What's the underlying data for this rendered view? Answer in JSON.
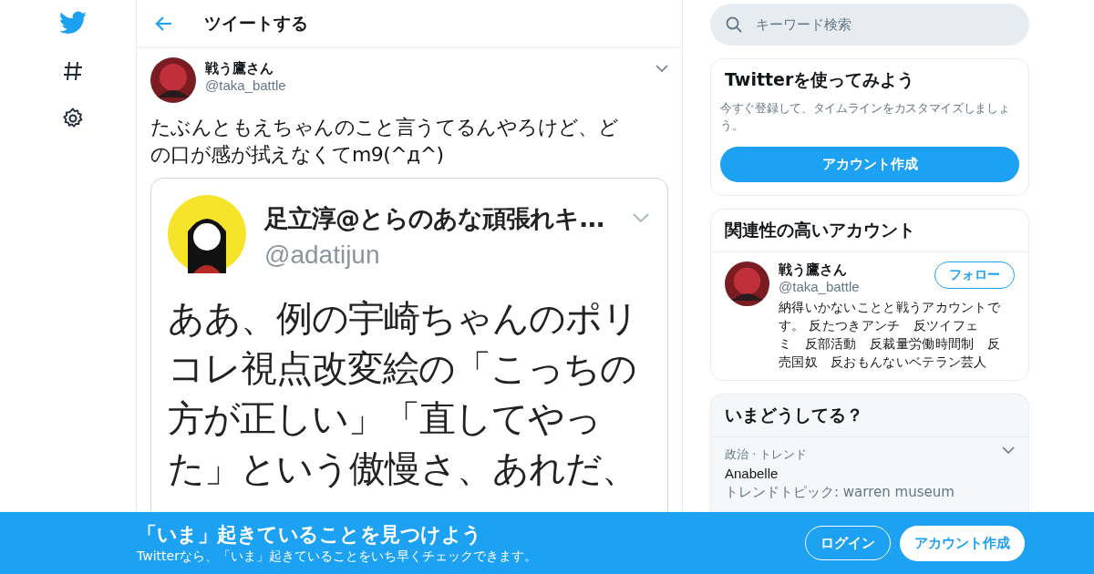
{
  "header": {
    "title": "ツイートする"
  },
  "tweet": {
    "name": "戦う鷹さん",
    "handle": "@taka_battle",
    "text_lines": [
      "たぶんともえちゃんのこと言うてるんやろけど、ど",
      "の口が感が拭えなくてm9(^д^)"
    ],
    "embedded_screenshot": {
      "name": "足立淳@とらのあな頑張れキ...",
      "handle": "@adatijun",
      "text_lines": [
        "ああ、例の宇崎ちゃんのポリ",
        "コレ視点改変絵の「こっちの",
        "方が正しい」「直してやっ",
        "た」という傲慢さ、あれだ、"
      ]
    }
  },
  "search": {
    "placeholder": "キーワード検索"
  },
  "signup_card": {
    "title": "Twitterを使ってみよう",
    "text": "今すぐ登録して、タイムラインをカスタマイズしましょう。",
    "button": "アカウント作成"
  },
  "related_card": {
    "title": "関連性の高いアカウント",
    "accounts": [
      {
        "name": "戦う鷹さん",
        "handle": "@taka_battle",
        "button": "フォロー",
        "bio_lines": [
          "納得いかないことと戦うアカウントで",
          "す。 反たつきアンチ　反ツイフェ",
          "ミ　反部活動　反裁量労働時間制　反",
          "売国奴　反おもんないベテラン芸人"
        ]
      }
    ]
  },
  "trends_card": {
    "title": "いまどうしてる？",
    "trends": [
      {
        "context": "政治 · トレンド",
        "name": "Anabelle",
        "topic": "トレンドトピック: warren museum"
      }
    ]
  },
  "banner": {
    "title": "「いま」起きていることを見つけよう",
    "subtitle": "Twitterなら、「いま」起きていることをいち早くチェックできます。",
    "login": "ログイン",
    "signup": "アカウント作成"
  }
}
